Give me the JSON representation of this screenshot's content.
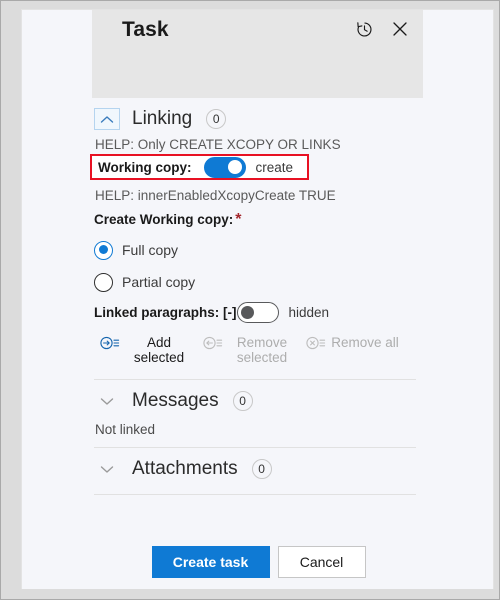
{
  "header": {
    "title": "Task",
    "history_icon": "history-icon",
    "close_icon": "close-icon"
  },
  "sections": {
    "linking": {
      "title": "Linking",
      "badge": "0",
      "expanded": true,
      "chevron": "chevron-up-icon",
      "help_top": "HELP: Only CREATE XCOPY OR LINKS",
      "working_copy": {
        "label": "Working copy:",
        "toggle_state": "on",
        "toggle_text": "create",
        "highlight_color": "#e81123"
      },
      "help_mid": "HELP: innerEnabledXcopyCreate TRUE",
      "create_working_copy": {
        "label": "Create Working copy:",
        "required_marker": "*",
        "options": [
          {
            "label": "Full copy",
            "selected": true
          },
          {
            "label": "Partial copy",
            "selected": false
          }
        ]
      },
      "linked_paragraphs": {
        "label": "Linked paragraphs: [-]",
        "toggle_state": "off",
        "toggle_text": "hidden"
      },
      "commands": [
        {
          "label": "Add selected",
          "icon": "add-selected-icon",
          "enabled": true
        },
        {
          "label": "Remove selected",
          "icon": "remove-selected-icon",
          "enabled": false
        },
        {
          "label": "Remove all",
          "icon": "remove-all-icon",
          "enabled": false
        }
      ]
    },
    "messages": {
      "title": "Messages",
      "badge": "0",
      "chevron": "chevron-down-icon",
      "note": "Not linked"
    },
    "attachments": {
      "title": "Attachments",
      "badge": "0",
      "chevron": "chevron-down-icon"
    }
  },
  "footer": {
    "primary_label": "Create task",
    "secondary_label": "Cancel",
    "accent_color": "#0f7ad4"
  }
}
